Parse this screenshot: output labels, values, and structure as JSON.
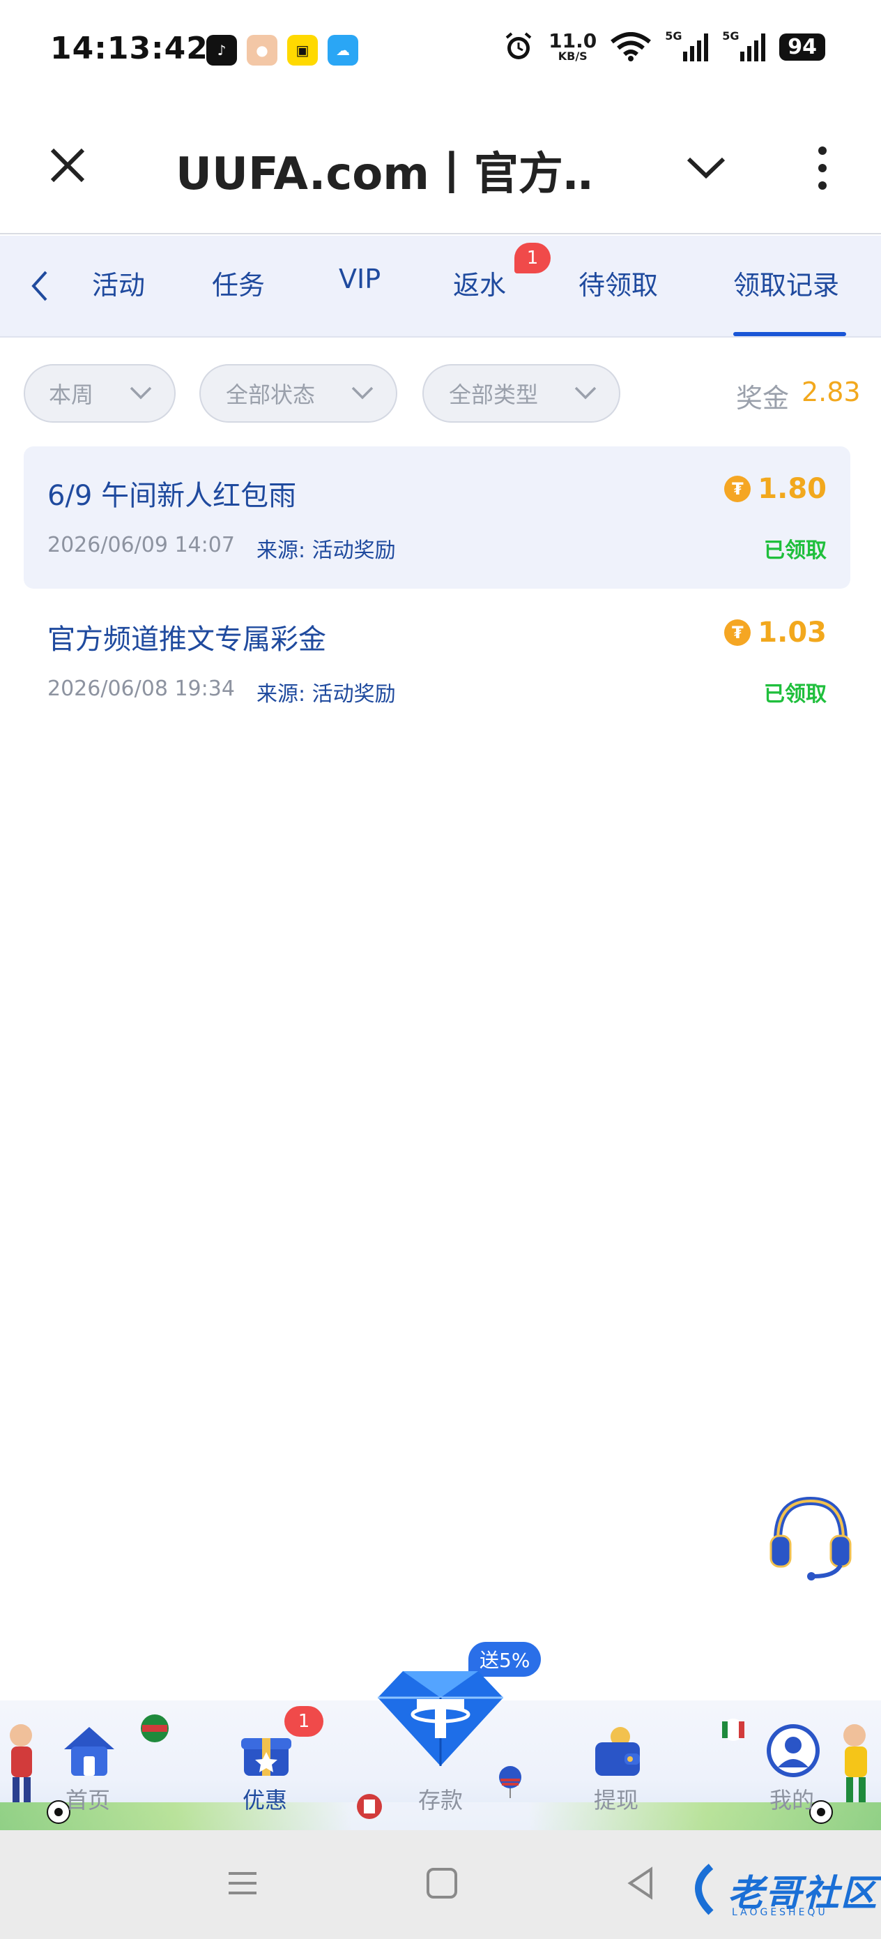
{
  "status_bar": {
    "time": "14:13:42",
    "net_speed": "11.0",
    "net_unit": "KB/S",
    "sim1": "5G",
    "sim2": "5G",
    "battery": "94"
  },
  "browser": {
    "title": "UUFA.com丨官方…"
  },
  "tabs": {
    "items": [
      {
        "label": "活动"
      },
      {
        "label": "任务"
      },
      {
        "label": "VIP"
      },
      {
        "label": "返水"
      },
      {
        "label": "待领取"
      },
      {
        "label": "领取记录"
      }
    ],
    "active": "领取记录",
    "badge": "1"
  },
  "filters": {
    "period": "本周",
    "status": "全部状态",
    "type": "全部类型",
    "bonus_label": "奖金",
    "bonus_value": "2.83"
  },
  "records": [
    {
      "title": "6/9 午间新人红包雨",
      "date": "2026/06/09 14:07",
      "source": "来源: 活动奖励",
      "amount": "1.80",
      "status": "已领取"
    },
    {
      "title": "官方频道推文专属彩金",
      "date": "2026/06/08 19:34",
      "source": "来源: 活动奖励",
      "amount": "1.03",
      "status": "已领取"
    }
  ],
  "bottom_nav": {
    "items": [
      {
        "label": "首页"
      },
      {
        "label": "优惠"
      },
      {
        "label": "存款"
      },
      {
        "label": "提现"
      },
      {
        "label": "我的"
      }
    ],
    "active": "优惠",
    "promo_badge": "1",
    "deposit_tag": "送5%"
  },
  "watermark": {
    "text": "老哥社区",
    "sub": "LAOGESHEQU"
  },
  "colors": {
    "accent": "#1f4a9e",
    "gold": "#f2a81d",
    "success": "#1fbf3c",
    "badge": "#f04a4a"
  }
}
